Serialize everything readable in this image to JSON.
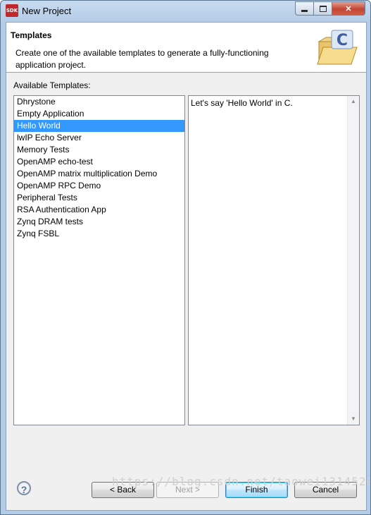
{
  "window": {
    "title": "New Project",
    "icon_text": "SDK",
    "controls": {
      "minimize": "minimize-icon",
      "maximize": "maximize-icon",
      "close": "close-icon"
    }
  },
  "header": {
    "title": "Templates",
    "description": "Create one of the available templates to generate a fully-functioning application project.",
    "art_letter": "C"
  },
  "templates": {
    "label": "Available Templates:",
    "selected_index": 2,
    "items": [
      "Dhrystone",
      "Empty Application",
      "Hello World",
      "lwIP Echo Server",
      "Memory Tests",
      "OpenAMP echo-test",
      "OpenAMP matrix multiplication Demo",
      "OpenAMP RPC Demo",
      "Peripheral Tests",
      "RSA Authentication App",
      "Zynq DRAM tests",
      "Zynq FSBL"
    ]
  },
  "description_pane": {
    "text": "Let's say 'Hello World' in C."
  },
  "buttons": {
    "help": "?",
    "back": "< Back",
    "next": "Next >",
    "finish": "Finish",
    "cancel": "Cancel"
  },
  "watermark": "https://blog.csdn.net/taowei1314520"
}
